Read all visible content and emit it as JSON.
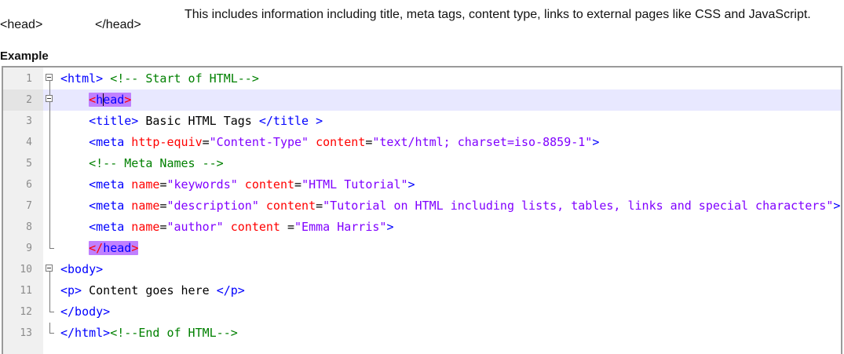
{
  "definition": {
    "open_tag": "<head>",
    "close_tag": "</head>",
    "description": "This includes information including title, meta tags, content type, links to external pages like CSS and JavaScript."
  },
  "example_label": "Example",
  "editor": {
    "line_numbers": [
      "1",
      "2",
      "3",
      "4",
      "5",
      "6",
      "7",
      "8",
      "9",
      "10",
      "11",
      "12",
      "13"
    ],
    "current_line": 2,
    "lines": [
      {
        "segments": [
          {
            "t": "<html>",
            "c": "tg"
          },
          {
            "t": " <!-- Start of HTML-->",
            "c": "cm"
          }
        ]
      },
      {
        "segments": [
          {
            "t": "    ",
            "c": "tx"
          },
          {
            "t": "<head>",
            "c": "hl"
          }
        ]
      },
      {
        "segments": [
          {
            "t": "    ",
            "c": "tx"
          },
          {
            "t": "<title>",
            "c": "tg"
          },
          {
            "t": " Basic HTML Tags ",
            "c": "tx"
          },
          {
            "t": "</title >",
            "c": "tg"
          }
        ]
      },
      {
        "segments": [
          {
            "t": "    ",
            "c": "tx"
          },
          {
            "t": "<meta",
            "c": "tg"
          },
          {
            "t": " http-equiv",
            "c": "at"
          },
          {
            "t": "=",
            "c": "tx"
          },
          {
            "t": "\"Content-Type\"",
            "c": "av"
          },
          {
            "t": " content",
            "c": "at"
          },
          {
            "t": "=",
            "c": "tx"
          },
          {
            "t": "\"text/html; charset=iso-8859-1\"",
            "c": "av"
          },
          {
            "t": ">",
            "c": "tg"
          }
        ]
      },
      {
        "segments": [
          {
            "t": "    ",
            "c": "tx"
          },
          {
            "t": "<!-- Meta Names -->",
            "c": "cm"
          }
        ]
      },
      {
        "segments": [
          {
            "t": "    ",
            "c": "tx"
          },
          {
            "t": "<meta",
            "c": "tg"
          },
          {
            "t": " name",
            "c": "at"
          },
          {
            "t": "=",
            "c": "tx"
          },
          {
            "t": "\"keywords\"",
            "c": "av"
          },
          {
            "t": " content",
            "c": "at"
          },
          {
            "t": "=",
            "c": "tx"
          },
          {
            "t": "\"HTML Tutorial\"",
            "c": "av"
          },
          {
            "t": ">",
            "c": "tg"
          }
        ]
      },
      {
        "segments": [
          {
            "t": "    ",
            "c": "tx"
          },
          {
            "t": "<meta",
            "c": "tg"
          },
          {
            "t": " name",
            "c": "at"
          },
          {
            "t": "=",
            "c": "tx"
          },
          {
            "t": "\"description\"",
            "c": "av"
          },
          {
            "t": " content",
            "c": "at"
          },
          {
            "t": "=",
            "c": "tx"
          },
          {
            "t": "\"Tutorial on HTML including lists, tables, links and special characters\"",
            "c": "av"
          },
          {
            "t": ">",
            "c": "tg"
          }
        ]
      },
      {
        "segments": [
          {
            "t": "    ",
            "c": "tx"
          },
          {
            "t": "<meta",
            "c": "tg"
          },
          {
            "t": " name",
            "c": "at"
          },
          {
            "t": "=",
            "c": "tx"
          },
          {
            "t": "\"author\"",
            "c": "av"
          },
          {
            "t": " content ",
            "c": "at"
          },
          {
            "t": "=",
            "c": "tx"
          },
          {
            "t": "\"Emma Harris\"",
            "c": "av"
          },
          {
            "t": ">",
            "c": "tg"
          }
        ]
      },
      {
        "segments": [
          {
            "t": "    ",
            "c": "tx"
          },
          {
            "t": "</head>",
            "c": "hl"
          }
        ]
      },
      {
        "segments": [
          {
            "t": "<body>",
            "c": "tg"
          }
        ]
      },
      {
        "segments": [
          {
            "t": "<p>",
            "c": "tg"
          },
          {
            "t": " Content goes here ",
            "c": "tx"
          },
          {
            "t": "</p>",
            "c": "tg"
          }
        ]
      },
      {
        "segments": [
          {
            "t": "</body>",
            "c": "tg"
          }
        ]
      },
      {
        "segments": [
          {
            "t": "</html>",
            "c": "tg"
          },
          {
            "t": "<!--End of HTML-->",
            "c": "cm"
          }
        ]
      }
    ],
    "fold_markers": [
      "box",
      "box",
      "line",
      "line",
      "line",
      "line",
      "line",
      "line",
      "end",
      "box",
      "line",
      "end",
      "end"
    ],
    "colors": {
      "tag": "#0000ff",
      "attribute": "#ff0000",
      "attribute_value": "#8000ff",
      "comment": "#008000",
      "current_line_bg": "#e8e8ff",
      "match_highlight": "#c080ff"
    }
  }
}
